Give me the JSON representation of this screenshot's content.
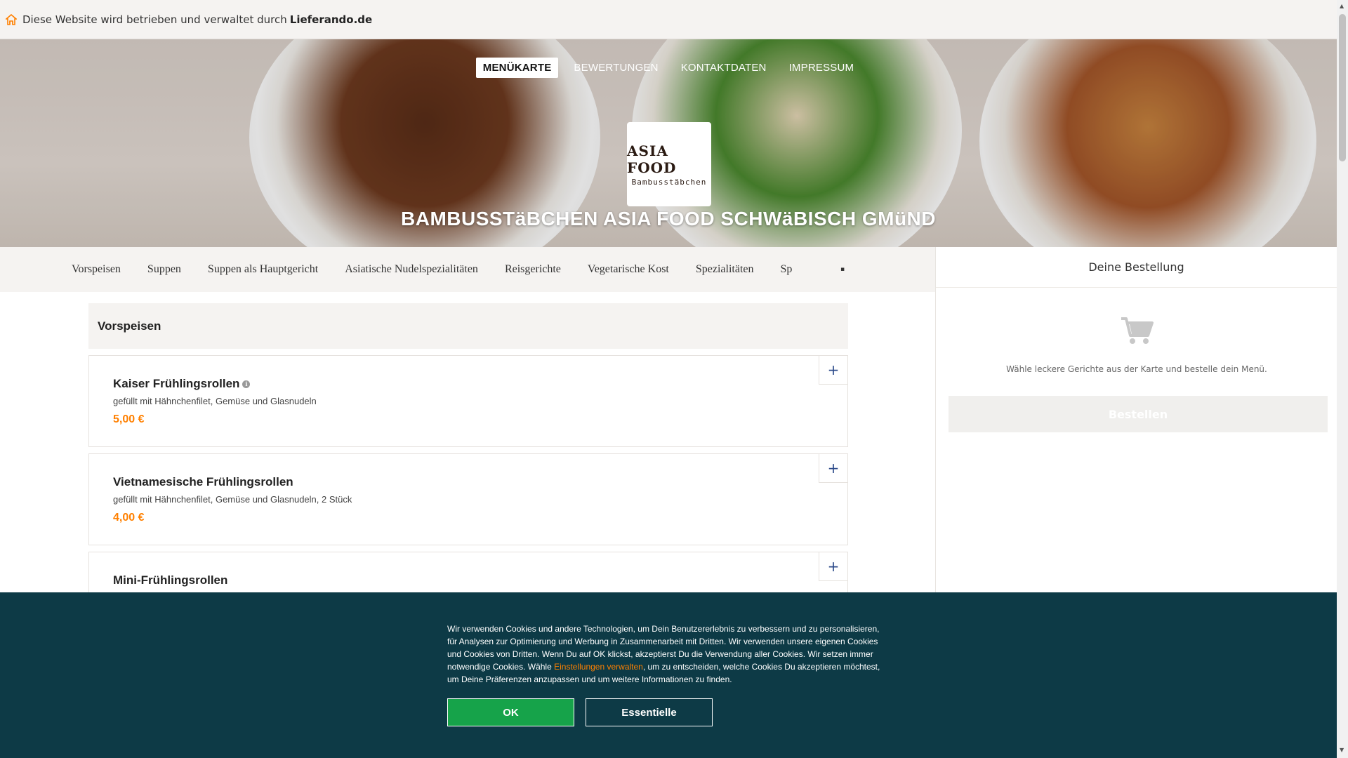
{
  "notice": {
    "text": "Diese Website wird betrieben und verwaltet durch",
    "brand": "Lieferando.de",
    "icon": "home-icon",
    "icon_color": "#ff8000"
  },
  "hero": {
    "nav": [
      {
        "label": "MENÜKARTE",
        "active": true
      },
      {
        "label": "BEWERTUNGEN",
        "active": false
      },
      {
        "label": "KONTAKTDATEN",
        "active": false
      },
      {
        "label": "IMPRESSUM",
        "active": false
      }
    ],
    "logo": {
      "main": "ASIA FOOD",
      "sub": "Bambusstäbchen"
    },
    "title": "BAMBUSSTäBCHEN ASIA FOOD SCHWäBISCH GMüND"
  },
  "categories": [
    "Vorspeisen",
    "Suppen",
    "Suppen als Hauptgericht",
    "Asiatische Nudelspezialitäten",
    "Reisgerichte",
    "Vegetarische Kost",
    "Spezialitäten",
    "Sp"
  ],
  "menu": {
    "section_title": "Vorspeisen",
    "dishes": [
      {
        "name": "Kaiser Frühlingsrollen",
        "has_info": true,
        "description": "gefüllt mit Hähnchenfilet, Gemüse und Glasnudeln",
        "price": "5,00 €"
      },
      {
        "name": "Vietnamesische Frühlingsrollen",
        "has_info": false,
        "description": "gefüllt mit Hähnchenfilet, Gemüse und Glasnudeln, 2 Stück",
        "price": "4,00 €"
      },
      {
        "name": "Mini-Frühlingsrollen",
        "has_info": false,
        "description": "",
        "price": ""
      }
    ],
    "add_label": "+"
  },
  "sidebar": {
    "title": "Deine Bestellung",
    "icon": "cart-icon",
    "hint": "Wähle leckere Gerichte aus der Karte und bestelle dein Menü.",
    "order_button": "Bestellen"
  },
  "cookie": {
    "text_before": "Wir verwenden Cookies und andere Technologien, um Dein Benutzererlebnis zu verbessern und zu personalisieren, für Analysen zur Optimierung und Werbung in Zusammenarbeit mit Dritten. Wir verwenden unsere eigenen Cookies und Cookies von Dritten. Wenn Du auf OK klickst, akzeptierst Du die Verwendung aller Cookies. Wir setzen immer notwendige Cookies. Wähle ",
    "link": "Einstellungen verwalten",
    "text_after": ", um zu entscheiden, welche Cookies Du akzeptieren möchtest, um Deine Präferenzen anzupassen und um weitere Informationen zu finden.",
    "ok": "OK",
    "essential": "Essentielle",
    "bg_color": "#0d3a46",
    "ok_color": "#16a34a"
  }
}
